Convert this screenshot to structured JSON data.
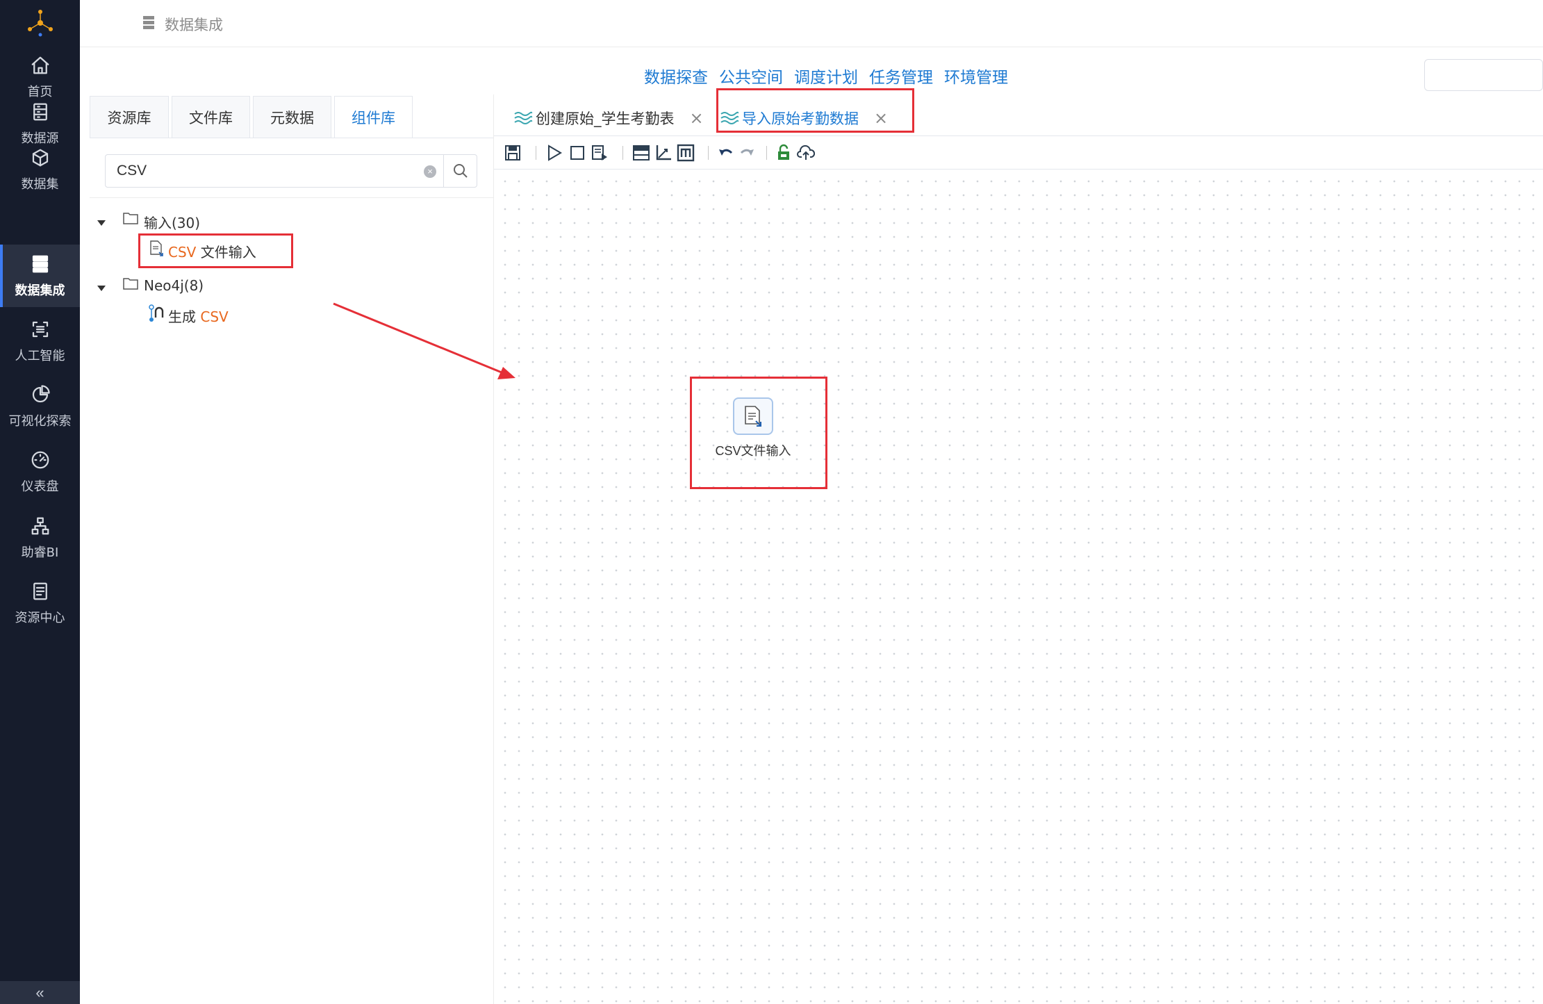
{
  "sidebar": {
    "items": [
      {
        "label": "首页",
        "icon": "home-icon"
      },
      {
        "label": "数据源",
        "icon": "database-icon"
      },
      {
        "label": "数据集",
        "icon": "cube-icon"
      },
      {
        "label": "数据集成",
        "icon": "server-icon",
        "active": true
      },
      {
        "label": "人工智能",
        "icon": "ai-scan-icon"
      },
      {
        "label": "可视化探索",
        "icon": "pie-chart-icon"
      },
      {
        "label": "仪表盘",
        "icon": "gauge-icon"
      },
      {
        "label": "助睿BI",
        "icon": "org-tree-icon"
      },
      {
        "label": "资源中心",
        "icon": "document-icon"
      }
    ],
    "collapse_label": "«"
  },
  "header": {
    "breadcrumb": "数据集成"
  },
  "top_nav": [
    "数据探查",
    "公共空间",
    "调度计划",
    "任务管理",
    "环境管理"
  ],
  "left_panel": {
    "tabs": [
      "资源库",
      "文件库",
      "元数据",
      "组件库"
    ],
    "active_tab": "组件库",
    "search_value": "CSV",
    "tree": {
      "group1": {
        "label": "输入(30)",
        "child_hl": "CSV",
        "child_rest": " 文件输入"
      },
      "group2": {
        "label": "Neo4j(8)",
        "child_rest": "生成 ",
        "child_hl": "CSV"
      }
    }
  },
  "editor": {
    "tabs": [
      {
        "label": "创建原始_学生考勤表",
        "close": "×"
      },
      {
        "label": "导入原始考勤数据",
        "close": "×",
        "active": true
      }
    ],
    "toolbar": [
      "save-icon",
      "run-icon",
      "stop-icon",
      "preview-icon",
      "grid-icon",
      "axis-icon",
      "metric-icon",
      "undo-icon",
      "redo-icon",
      "lock-icon",
      "upload-icon"
    ],
    "node": {
      "label": "CSV文件输入",
      "icon": "csv-file-icon"
    }
  },
  "colors": {
    "sidebar_bg": "#161c2c",
    "accent": "#1e7ad2",
    "highlight": "#e8681f",
    "annotation_red": "#e52f37"
  }
}
